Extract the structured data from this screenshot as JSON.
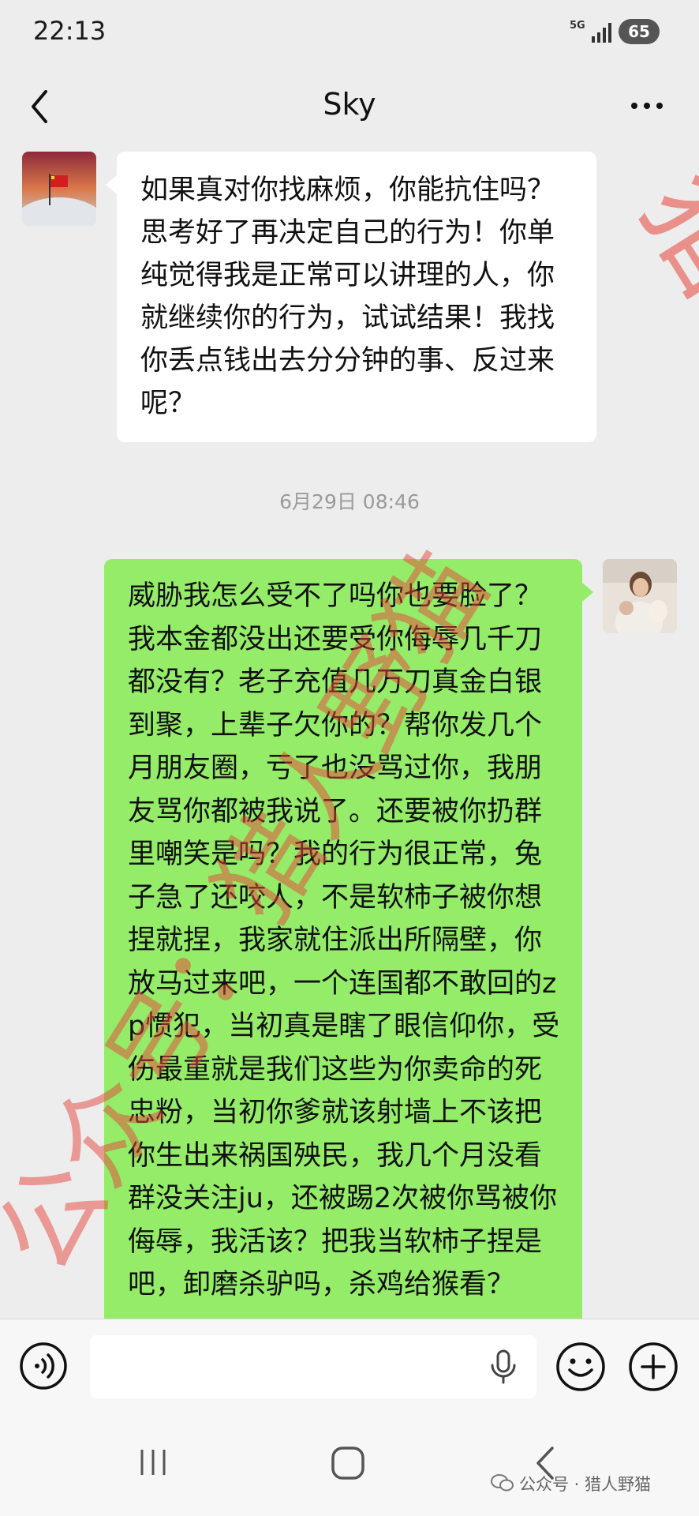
{
  "status_bar": {
    "time": "22:13",
    "network": "5G",
    "battery": "65"
  },
  "header": {
    "title": "Sky"
  },
  "messages": {
    "incoming_text": "如果真对你找麻烦，你能抗住吗？思考好了再决定自己的行为！你单纯觉得我是正常可以讲理的人，你就继续你的行为，试试结果！我找你丢点钱出去分分钟的事、反过来呢？",
    "timestamp": "6月29日 08:46",
    "outgoing_text": "威胁我怎么受不了吗你也要脸了？我本金都没出还要受你侮辱几千刀都没有？老子充值几万刀真金白银到聚，上辈子欠你的？帮你发几个月朋友圈，亏了也没骂过你，我朋友骂你都被我说了。还要被你扔群里嘲笑是吗？我的行为很正常，兔子急了还咬人，不是软柿子被你想捏就捏，我家就住派出所隔壁，你放马过来吧，一个连国都不敢回的zp惯犯，当初真是瞎了眼信仰你，受伤最重就是我们这些为你卖命的死忠粉，当初你爹就该射墙上不该把你生出来祸国殃民，我几个月没看群没关注ju，还被踢2次被你骂被你侮辱，我活该？把我当软柿子捏是吧，卸磨杀驴吗，杀鸡给猴看？"
  },
  "input_bar": {
    "value": "",
    "placeholder": ""
  },
  "footer": {
    "account_label": "公众号 · 猎人野猫"
  },
  "overlay": {
    "watermark_right": "猎人野猫",
    "watermark_left": "公众号：猎人野猫",
    "color": "#e8433a"
  },
  "colors": {
    "background": "#ededed",
    "incoming_bubble": "#ffffff",
    "outgoing_bubble": "#95ec69"
  },
  "icons": {
    "back": "chevron-left-icon",
    "more": "more-dots-icon",
    "voice": "voice-wave-icon",
    "mic": "microphone-icon",
    "emoji": "smiley-icon",
    "plus": "plus-circle-icon"
  }
}
